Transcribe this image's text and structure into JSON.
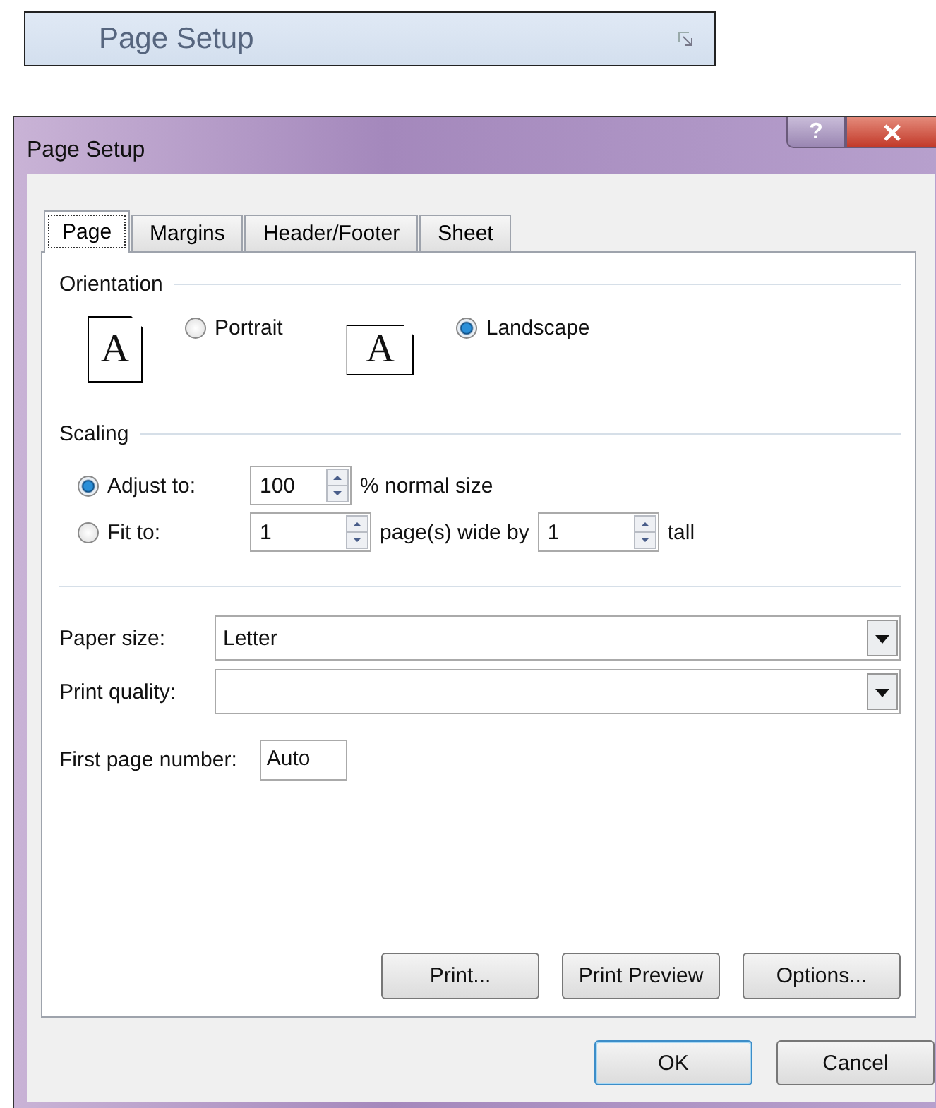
{
  "ribbon_group": {
    "label": "Page Setup"
  },
  "window": {
    "title": "Page Setup",
    "help_label": "?"
  },
  "tabs": [
    {
      "label": "Page",
      "selected": true
    },
    {
      "label": "Margins",
      "selected": false
    },
    {
      "label": "Header/Footer",
      "selected": false
    },
    {
      "label": "Sheet",
      "selected": false
    }
  ],
  "orientation": {
    "title": "Orientation",
    "options": [
      {
        "kind": "portrait",
        "icon_letter": "A",
        "label": "Portrait",
        "selected": false
      },
      {
        "kind": "landscape",
        "icon_letter": "A",
        "label": "Landscape",
        "selected": true
      }
    ]
  },
  "scaling": {
    "title": "Scaling",
    "options": [
      {
        "label": "Adjust to:",
        "selected": true,
        "parts": [
          {
            "kind": "spin",
            "value": "100"
          },
          {
            "kind": "text",
            "text": "% normal size"
          }
        ]
      },
      {
        "label": "Fit to:",
        "selected": false,
        "parts": [
          {
            "kind": "spin",
            "value": "1"
          },
          {
            "kind": "text",
            "text": "page(s) wide by"
          },
          {
            "kind": "spin",
            "value": "1"
          },
          {
            "kind": "text",
            "text": "tall"
          }
        ]
      }
    ]
  },
  "paper_size": {
    "label": "Paper size:",
    "value": "Letter"
  },
  "print_quality": {
    "label": "Print quality:"
  },
  "first_page_number": {
    "label": "First page number:",
    "value": "Auto"
  },
  "panel_buttons": [
    "Print...",
    "Print Preview",
    "Options..."
  ],
  "dialog_buttons": [
    {
      "label": "OK",
      "default": true
    },
    {
      "label": "Cancel",
      "default": false
    }
  ]
}
